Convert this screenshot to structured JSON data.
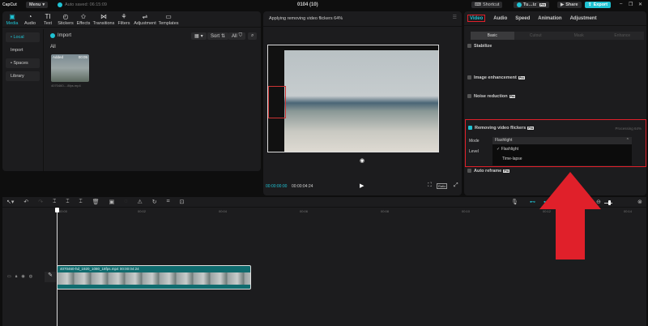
{
  "topbar": {
    "logo": "CapCut",
    "menu": "Menu",
    "autosave": "Auto saved: 06:15:09",
    "project_title": "0104 (10)",
    "shortcut": "Shortcut",
    "user": "Tu…iz",
    "share": "Share",
    "export": "Export"
  },
  "media_tabs": [
    {
      "label": "Media",
      "icon": "media-icon"
    },
    {
      "label": "Audio",
      "icon": "audio-icon"
    },
    {
      "label": "Text",
      "icon": "text-icon"
    },
    {
      "label": "Stickers",
      "icon": "stickers-icon"
    },
    {
      "label": "Effects",
      "icon": "effects-icon"
    },
    {
      "label": "Transitions",
      "icon": "transitions-icon"
    },
    {
      "label": "Filters",
      "icon": "filters-icon"
    },
    {
      "label": "Adjustment",
      "icon": "adjustment-icon"
    },
    {
      "label": "Templates",
      "icon": "templates-icon"
    }
  ],
  "sidebar": {
    "items": [
      "• Local",
      "Import",
      "• Spaces",
      "Library"
    ]
  },
  "media": {
    "import": "Import",
    "sort": "Sort",
    "all_filter": "All",
    "all_label": "All",
    "clip": {
      "badge": "Added",
      "duration": "00:05",
      "name": "4070460-...8fps.mp4"
    }
  },
  "preview": {
    "status": "Applying removing video flickers 64%",
    "current_time": "00:00:00:00",
    "total_time": "00:00:04:24",
    "ratio": "Ratio"
  },
  "inspector": {
    "tabs": [
      "Video",
      "Audio",
      "Speed",
      "Animation",
      "Adjustment"
    ],
    "subtabs": [
      "Basic",
      "Cutout",
      "Mask",
      "Enhance"
    ],
    "stabilize": "Stabilize",
    "image_enhancement": "Image enhancement",
    "noise_reduction": "Noise reduction",
    "pro": "Pro",
    "flicker": {
      "label": "Removing video flickers",
      "processing": "Processing 64%",
      "mode_label": "Mode",
      "mode_value": "Flashlight",
      "level_label": "Level",
      "options": [
        "Flashlight",
        "Time-lapse"
      ]
    },
    "auto_reframe": "Auto reframe"
  },
  "timeline": {
    "ruler": [
      "00:00",
      "00:02",
      "00:04",
      "00:06",
      "00:08",
      "00:10",
      "00:12",
      "00:14"
    ],
    "clip_label": "4070460-hd_1920_1080_18fps.mp4   00:00:04:24"
  },
  "colors": {
    "accent": "#1fc2d3",
    "highlight": "#e0202a",
    "clip": "#0f6b6e"
  }
}
